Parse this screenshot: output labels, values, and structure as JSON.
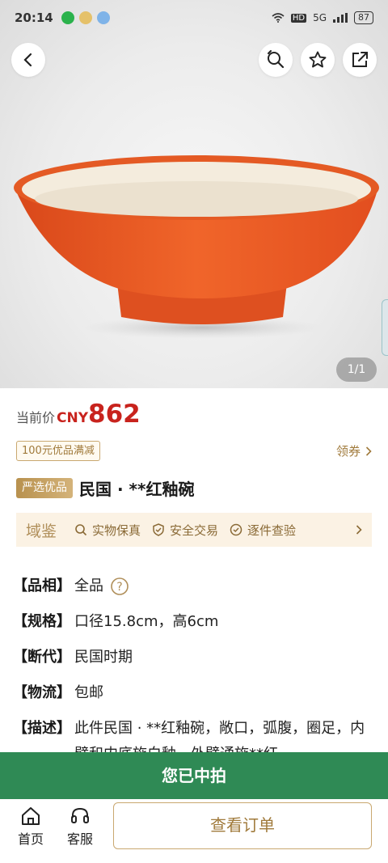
{
  "status_bar": {
    "time": "20:14",
    "network": "HD",
    "signal": "5G",
    "battery": "87"
  },
  "gallery": {
    "page_indicator": "1/1",
    "icons": [
      "back-icon",
      "search-icon",
      "star-icon",
      "share-icon"
    ]
  },
  "price": {
    "label": "当前价",
    "currency": "CNY",
    "value": "862"
  },
  "coupon": {
    "tag": "100元优品满减",
    "action": "领券"
  },
  "title": {
    "badge": "严选优品",
    "text": "民国 · **红釉碗"
  },
  "guarantee": {
    "brand": "域鉴",
    "items": [
      "实物保真",
      "安全交易",
      "逐件查验"
    ]
  },
  "specs": [
    {
      "key": "【品相】",
      "value": "全品"
    },
    {
      "key": "【规格】",
      "value": "口径15.8cm，高6cm"
    },
    {
      "key": "【断代】",
      "value": "民国时期"
    },
    {
      "key": "【物流】",
      "value": "包邮"
    },
    {
      "key": "【描述】",
      "value": "此件民国 · **红釉碗，敞口，弧腹，圈足，内壁和内底施白釉，外壁通施**红"
    }
  ],
  "won_banner": "您已中拍",
  "bottom_nav": {
    "home": "首页",
    "service": "客服",
    "order": "查看订单"
  },
  "colors": {
    "accent_red": "#c8231d",
    "gold": "#a07a3b",
    "green": "#2f8a55"
  }
}
